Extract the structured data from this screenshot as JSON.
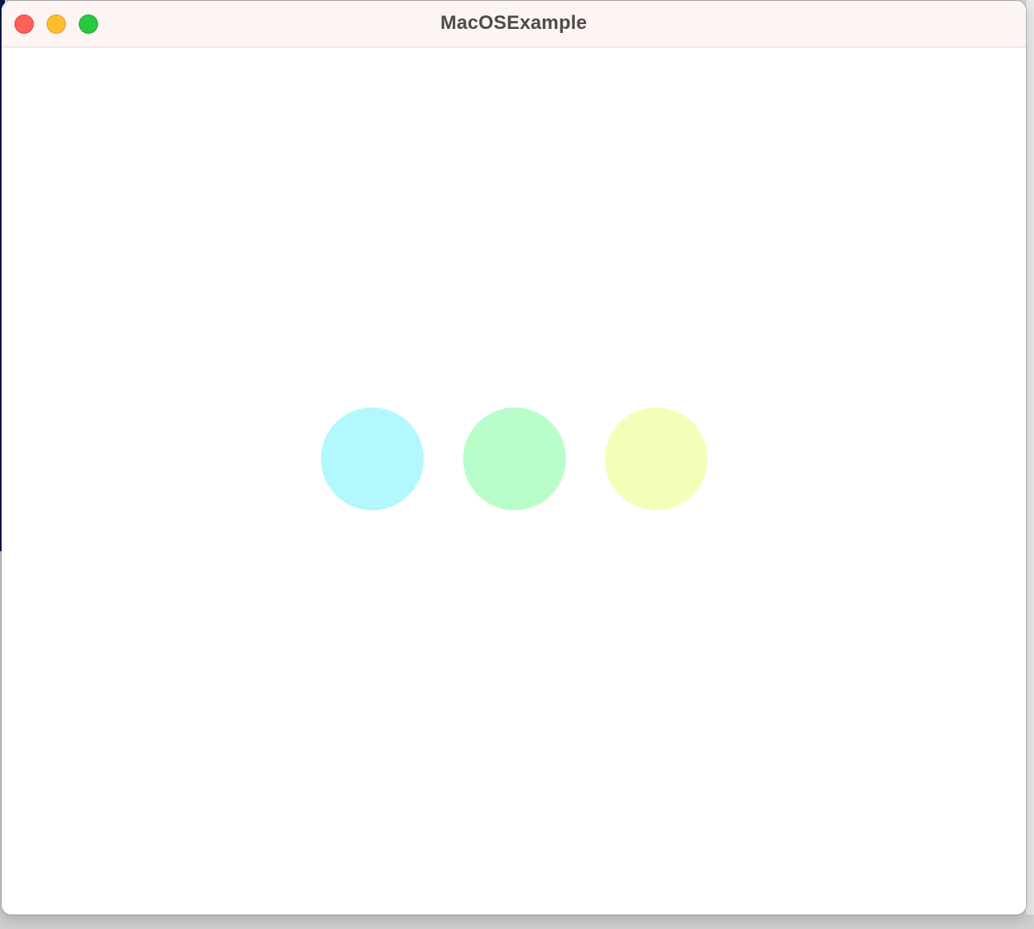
{
  "window": {
    "title": "MacOSExample"
  },
  "traffic_lights": [
    {
      "name": "close",
      "color": "#ff5f57"
    },
    {
      "name": "minimize",
      "color": "#febc2e"
    },
    {
      "name": "zoom",
      "color": "#28c840"
    }
  ],
  "dots": [
    {
      "color": "#b3f8fe"
    },
    {
      "color": "#b9feca"
    },
    {
      "color": "#f5feb8"
    }
  ]
}
